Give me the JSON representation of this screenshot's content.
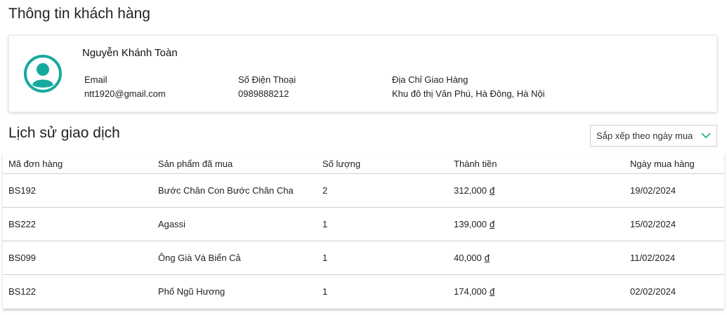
{
  "page_title": "Thông tin khách hàng",
  "customer": {
    "name": "Nguyễn Khánh Toàn",
    "email_label": "Email",
    "email": "ntt1920@gmail.com",
    "phone_label": "Số Điện Thoại",
    "phone": "0989888212",
    "address_label": "Địa Chỉ Giao Hàng",
    "address": "Khu đô thị Văn Phú, Hà Đông, Hà Nội",
    "avatar_icon": "user-avatar-icon",
    "accent_color": "#17a99e"
  },
  "history": {
    "title": "Lịch sử giao dịch",
    "sort_label": "Sắp xếp theo ngày mua",
    "columns": [
      "Mã đơn hàng",
      "Sản phẩm đã mua",
      "Số lượng",
      "Thành tiền",
      "Ngày mua hàng"
    ],
    "currency_symbol": "đ",
    "rows": [
      {
        "id": "BS192",
        "product": "Bước Chân Con Bước Chân Cha",
        "qty": "2",
        "amount": "312,000",
        "date": "19/02/2024"
      },
      {
        "id": "BS222",
        "product": "Agassi",
        "qty": "1",
        "amount": "139,000",
        "date": "15/02/2024"
      },
      {
        "id": "BS099",
        "product": "Ông Già Và Biển Cả",
        "qty": "1",
        "amount": "40,000",
        "date": "11/02/2024"
      },
      {
        "id": "BS122",
        "product": "Phố Ngũ Hương",
        "qty": "1",
        "amount": "174,000",
        "date": "02/02/2024"
      }
    ]
  }
}
